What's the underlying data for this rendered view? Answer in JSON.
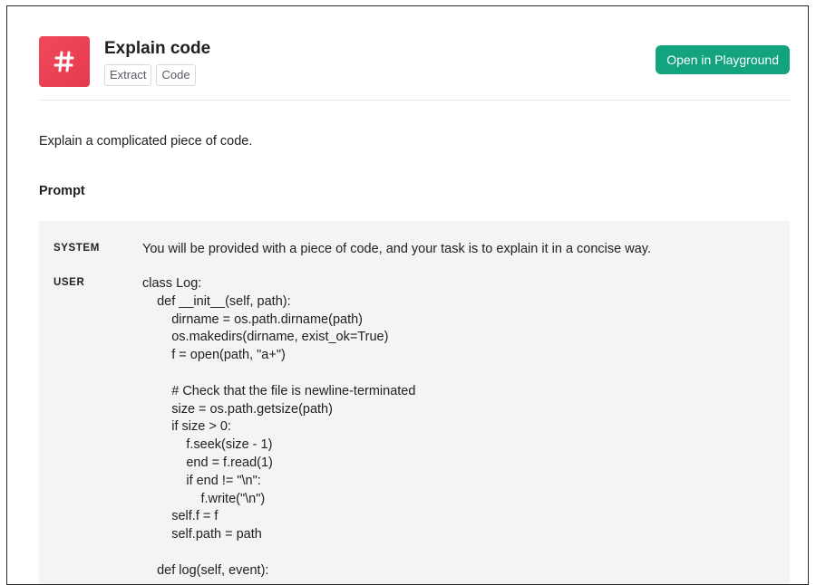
{
  "header": {
    "icon": "hash-icon",
    "icon_color": "#e63950",
    "title": "Explain code",
    "tags": [
      "Extract",
      "Code"
    ],
    "open_button_label": "Open in Playground",
    "open_button_color": "#13a37f"
  },
  "description": "Explain a complicated piece of code.",
  "prompt": {
    "heading": "Prompt",
    "messages": [
      {
        "role": "SYSTEM",
        "content": "You will be provided with a piece of code, and your task is to explain it in a concise way."
      },
      {
        "role": "USER",
        "content": "class Log:\n    def __init__(self, path):\n        dirname = os.path.dirname(path)\n        os.makedirs(dirname, exist_ok=True)\n        f = open(path, \"a+\")\n\n        # Check that the file is newline-terminated\n        size = os.path.getsize(path)\n        if size > 0:\n            f.seek(size - 1)\n            end = f.read(1)\n            if end != \"\\n\":\n                f.write(\"\\n\")\n        self.f = f\n        self.path = path\n\n    def log(self, event):"
      }
    ]
  }
}
